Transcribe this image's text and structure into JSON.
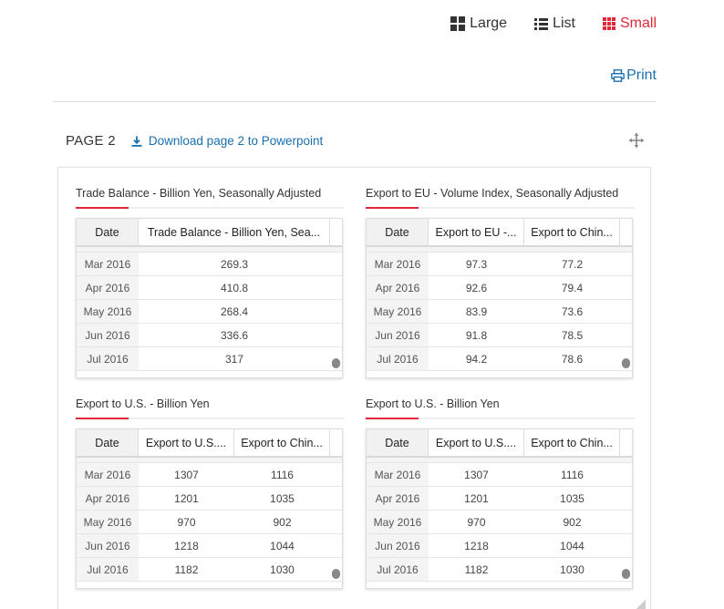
{
  "view_options": [
    {
      "label": "Large",
      "icon": "grid-large-icon",
      "active": false
    },
    {
      "label": "List",
      "icon": "list-icon",
      "active": false
    },
    {
      "label": "Small",
      "icon": "grid-small-icon",
      "active": true
    }
  ],
  "print_label": "Print",
  "page": {
    "title": "PAGE 2",
    "download_label": "Download page 2 to Powerpoint"
  },
  "accent_color": "#e0283a",
  "link_color": "#1a6fb0",
  "widgets": [
    {
      "title": "Trade Balance - Billion Yen, Seasonally Adjusted",
      "columns": [
        "Date",
        "Trade Balance - Billion Yen, Sea..."
      ],
      "rows": [
        [
          "Mar 2016",
          "269.3"
        ],
        [
          "Apr 2016",
          "410.8"
        ],
        [
          "May 2016",
          "268.4"
        ],
        [
          "Jun 2016",
          "336.6"
        ],
        [
          "Jul 2016",
          "317"
        ]
      ]
    },
    {
      "title": "Export to EU - Volume Index, Seasonally Adjusted",
      "columns": [
        "Date",
        "Export to EU -...",
        "Export to Chin..."
      ],
      "rows": [
        [
          "Mar 2016",
          "97.3",
          "77.2"
        ],
        [
          "Apr 2016",
          "92.6",
          "79.4"
        ],
        [
          "May 2016",
          "83.9",
          "73.6"
        ],
        [
          "Jun 2016",
          "91.8",
          "78.5"
        ],
        [
          "Jul 2016",
          "94.2",
          "78.6"
        ]
      ]
    },
    {
      "title": "Export to U.S. - Billion Yen",
      "columns": [
        "Date",
        "Export to U.S....",
        "Export to Chin..."
      ],
      "rows": [
        [
          "Mar 2016",
          "1307",
          "1116"
        ],
        [
          "Apr 2016",
          "1201",
          "1035"
        ],
        [
          "May 2016",
          "970",
          "902"
        ],
        [
          "Jun 2016",
          "1218",
          "1044"
        ],
        [
          "Jul 2016",
          "1182",
          "1030"
        ]
      ]
    },
    {
      "title": "Export to U.S. - Billion Yen",
      "columns": [
        "Date",
        "Export to U.S....",
        "Export to Chin..."
      ],
      "rows": [
        [
          "Mar 2016",
          "1307",
          "1116"
        ],
        [
          "Apr 2016",
          "1201",
          "1035"
        ],
        [
          "May 2016",
          "970",
          "902"
        ],
        [
          "Jun 2016",
          "1218",
          "1044"
        ],
        [
          "Jul 2016",
          "1182",
          "1030"
        ]
      ]
    }
  ]
}
